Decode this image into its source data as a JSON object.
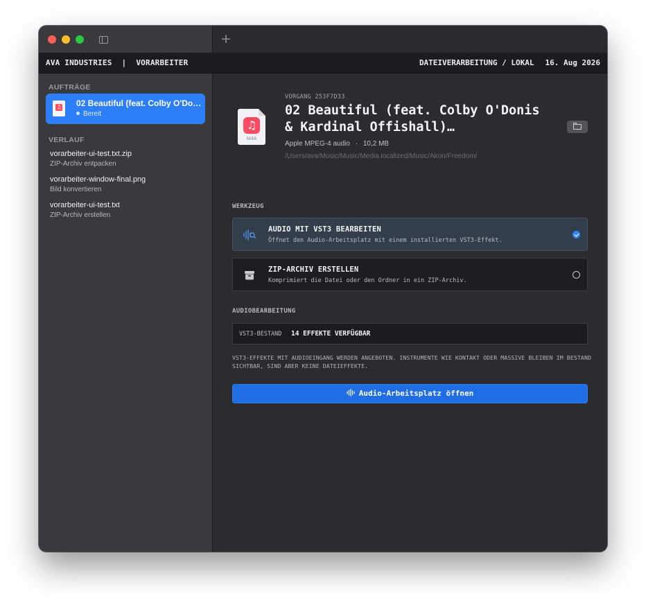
{
  "header": {
    "company": "AVA INDUSTRIES",
    "separator": "|",
    "app": "VORARBEITER",
    "mode": "DATEIVERARBEITUNG / LOKAL",
    "date": "16. Aug 2026"
  },
  "titlebar": {
    "new_tab": "+"
  },
  "sidebar": {
    "jobs_label": "AUFTRÄGE",
    "job": {
      "title": "02 Beautiful (feat. Colby O'Donis & Kardinal Offishall)",
      "status": "Bereit",
      "icon": "music-file-icon"
    },
    "history_label": "VERLAUF",
    "history": [
      {
        "title": "vorarbeiter-ui-test.txt.zip",
        "action": "ZIP-Archiv entpacken"
      },
      {
        "title": "vorarbeiter-window-final.png",
        "action": "Bild konvertieren"
      },
      {
        "title": "vorarbeiter-ui-test.txt",
        "action": "ZIP-Archiv erstellen"
      }
    ]
  },
  "main": {
    "vorgang": "VORGANG 253F7D33",
    "file_title": "02 Beautiful (feat. Colby O'Donis & Kardinal Offishall)…",
    "file_ext": "M4A",
    "file_type": "Apple MPEG-4 audio",
    "meta_sep": "·",
    "file_size": "10,2 MB",
    "file_path": "/Users/ava/Music/Music/Media.localized/Music/Akon/Freedom/",
    "tools_label": "WERKZEUG",
    "tools": [
      {
        "title": "AUDIO MIT VST3 BEARBEITEN",
        "desc": "Öffnet den Audio-Arbeitsplatz mit einem installierten VST3-Effekt.",
        "selected": true,
        "icon": "audio-waveform-icon"
      },
      {
        "title": "ZIP-ARCHIV ERSTELLEN",
        "desc": "Komprimiert die Datei oder den Ordner in ein ZIP-Archiv.",
        "selected": false,
        "icon": "archive-box-icon"
      }
    ],
    "audio_label": "AUDIOBEARBEITUNG",
    "vst_key": "VST3-BESTAND",
    "vst_value": "14 EFFEKTE VERFÜGBAR",
    "note": "VST3-EFFEKTE MIT AUDIOEINGANG WERDEN ANGEBOTEN. INSTRUMENTE WIE KONTAKT ODER MASSIVE BLEIBEN IM BESTAND SICHTBAR, SIND ABER KEINE DATEIEFFEKTE.",
    "cta": "Audio-Arbeitsplatz öffnen"
  },
  "colors": {
    "accent": "#2d7ff9",
    "button": "#1f6ee6",
    "music_icon": "#fb4a63"
  }
}
